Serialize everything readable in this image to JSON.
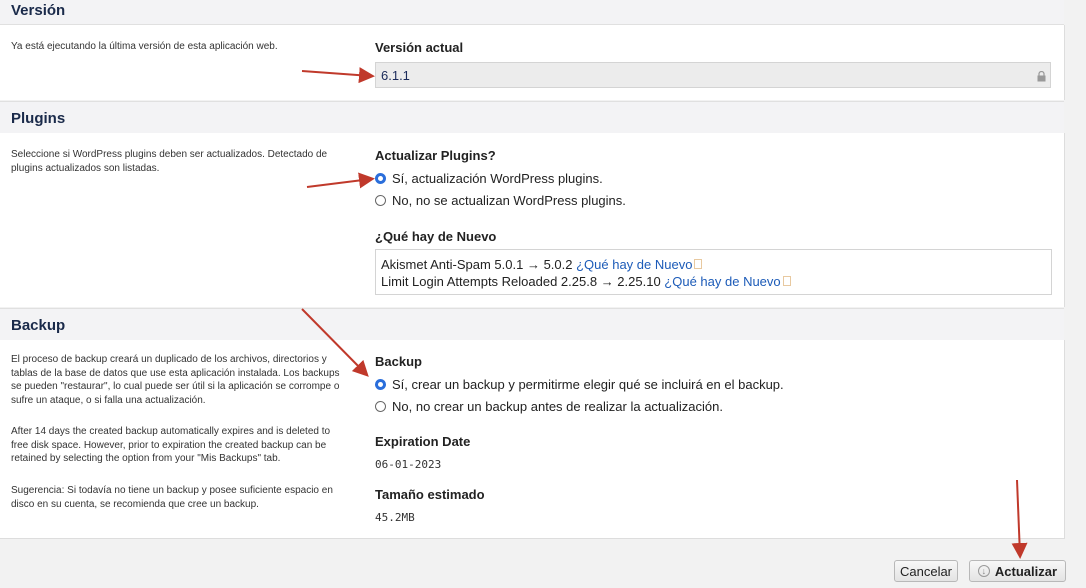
{
  "version": {
    "title": "Versión",
    "description": "Ya está ejecutando la última versión de esta aplicación web.",
    "current_label": "Versión actual",
    "current_value": "6.1.1",
    "lock_icon": "lock-icon"
  },
  "plugins": {
    "title": "Plugins",
    "description": "Seleccione si WordPress plugins deben ser actualizados. Detectado de plugins actualizados son listadas.",
    "question": "Actualizar Plugins?",
    "options": [
      {
        "label": "Sí, actualización WordPress plugins.",
        "selected": true
      },
      {
        "label": "No, no se actualizan WordPress plugins.",
        "selected": false
      }
    ],
    "whats_new_label": "¿Qué hay de Nuevo",
    "updates": [
      {
        "text": "Akismet Anti-Spam 5.0.1 → 5.0.2 ",
        "link": "¿Qué hay de Nuevo"
      },
      {
        "text": "Limit Login Attempts Reloaded 2.25.8 → 2.25.10 ",
        "link": "¿Qué hay de Nuevo"
      }
    ]
  },
  "backup": {
    "title": "Backup",
    "description_1": "El proceso de backup creará un duplicado de los archivos, directorios y tablas de la base de datos que use esta aplicación instalada. Los backups se pueden \"restaurar\", lo cual puede ser útil si la aplicación se corrompe o sufre un ataque, o si falla una actualización.",
    "description_2": "After 14 days the created backup automatically expires and is deleted to free disk space. However, prior to expiration the created backup can be retained by selecting the option from your \"Mis Backups\" tab.",
    "description_3": "Sugerencia: Si todavía no tiene un backup y posee suficiente espacio en disco en su cuenta, se recomienda que cree un backup.",
    "question": "Backup",
    "options": [
      {
        "label": "Sí, crear un backup y permitirme elegir qué se incluirá en el backup.",
        "selected": true
      },
      {
        "label": "No, no crear un backup antes de realizar la actualización.",
        "selected": false
      }
    ],
    "expiration_label": "Expiration Date",
    "expiration_value": "06-01-2023",
    "size_label": "Tamaño estimado",
    "size_value": "45.2MB"
  },
  "footer": {
    "cancel_label": "Cancelar",
    "update_label": "Actualizar",
    "update_icon": "download-circle-icon"
  },
  "colors": {
    "annotation_arrow": "#c0392b",
    "link": "#1c5bb8",
    "radio_selected": "#2a6edb"
  }
}
